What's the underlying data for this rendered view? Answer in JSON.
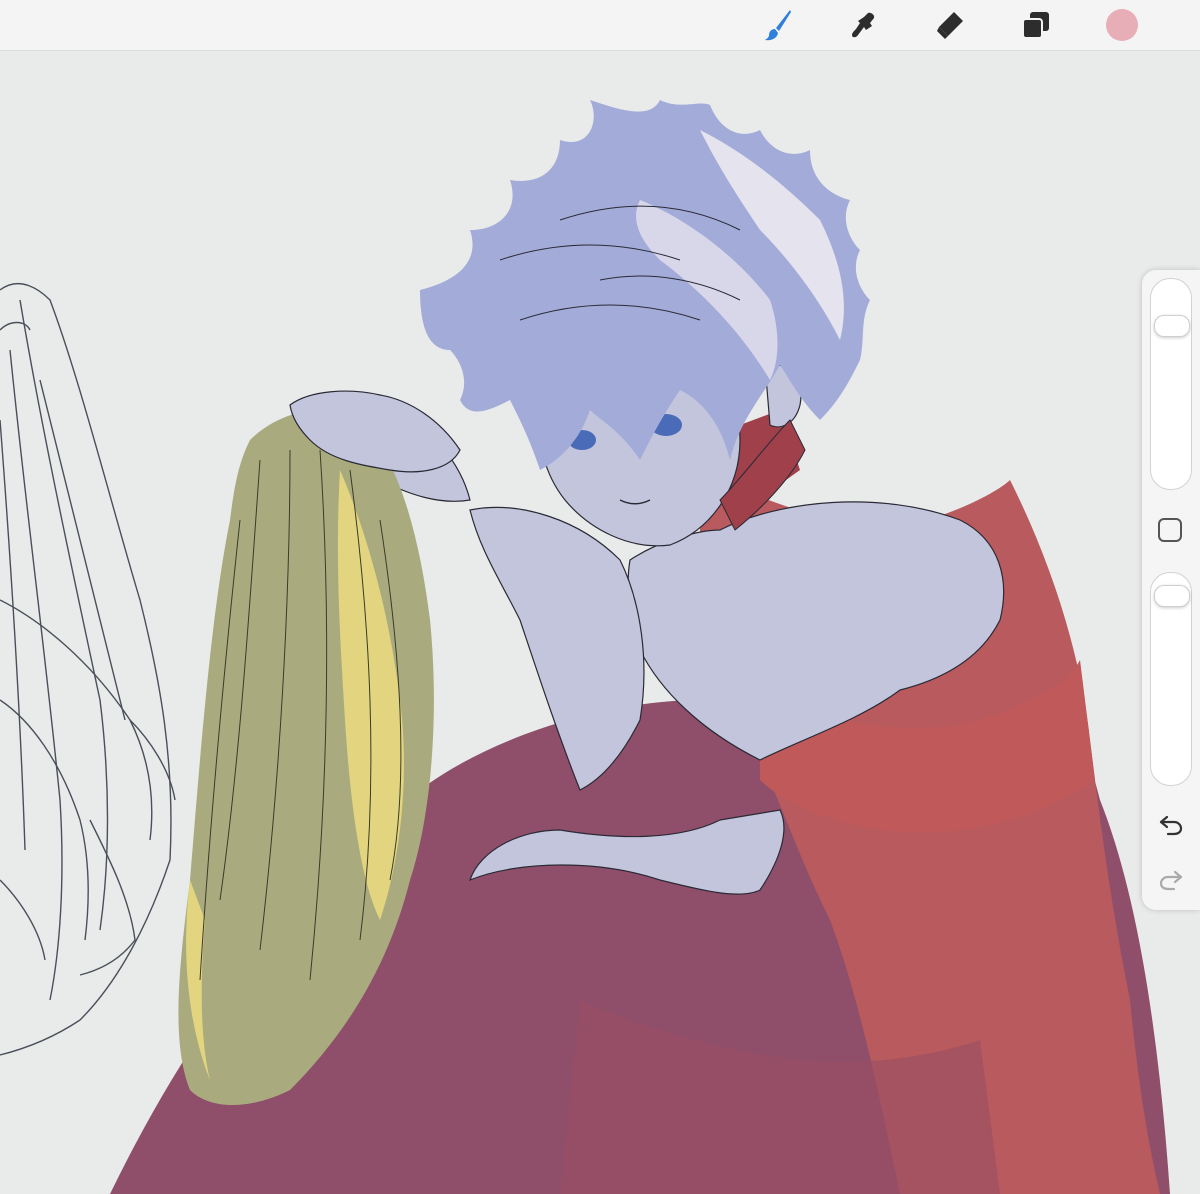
{
  "toolbar": {
    "tools": [
      {
        "name": "brush",
        "icon": "brush-icon",
        "active": true
      },
      {
        "name": "smudge",
        "icon": "smudge-icon",
        "active": false
      },
      {
        "name": "eraser",
        "icon": "eraser-icon",
        "active": false
      },
      {
        "name": "layers",
        "icon": "layers-icon",
        "active": false
      }
    ],
    "current_color": "#e8aeb7",
    "active_tool_color": "#2f7fdc"
  },
  "sidebar": {
    "brush_size_level": 0.82,
    "opacity_level": 0.95,
    "icons": [
      "modify-square-icon",
      "undo-icon",
      "redo-icon"
    ]
  },
  "colors": {
    "canvas_bg": "#e9ebea",
    "hair": "#a3acd9",
    "skin": "#c3c5dd",
    "dress": "#8f4f6a",
    "dress_light": "#c0595a",
    "wig": "#a9ab7f",
    "wig_light": "#e3d57f"
  }
}
